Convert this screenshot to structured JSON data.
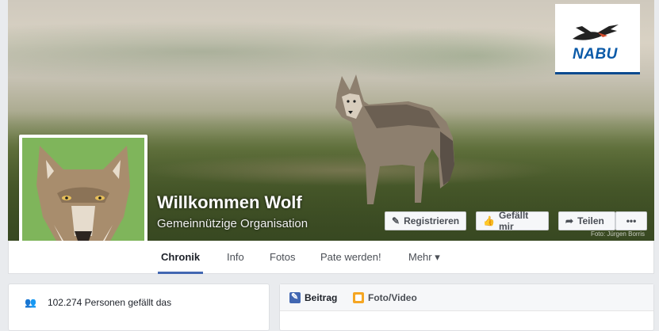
{
  "page": {
    "name": "Willkommen Wolf",
    "category": "Gemeinnützige Organisation",
    "photo_credit": "Foto: Jürgen Borris"
  },
  "logo": {
    "text": "NABU"
  },
  "actions": {
    "register": "Registrieren",
    "like": "Gefällt mir",
    "share": "Teilen",
    "more": "•••"
  },
  "tabs": [
    {
      "label": "Chronik"
    },
    {
      "label": "Info"
    },
    {
      "label": "Fotos"
    },
    {
      "label": "Pate werden!"
    },
    {
      "label": "Mehr ▾"
    }
  ],
  "sidebar": {
    "likes": "102.274 Personen gefällt das"
  },
  "composer": {
    "post_label": "Beitrag",
    "photo_label": "Foto/Video"
  },
  "colors": {
    "accent": "#4267b2",
    "nabu_blue": "#0b5aa8"
  }
}
